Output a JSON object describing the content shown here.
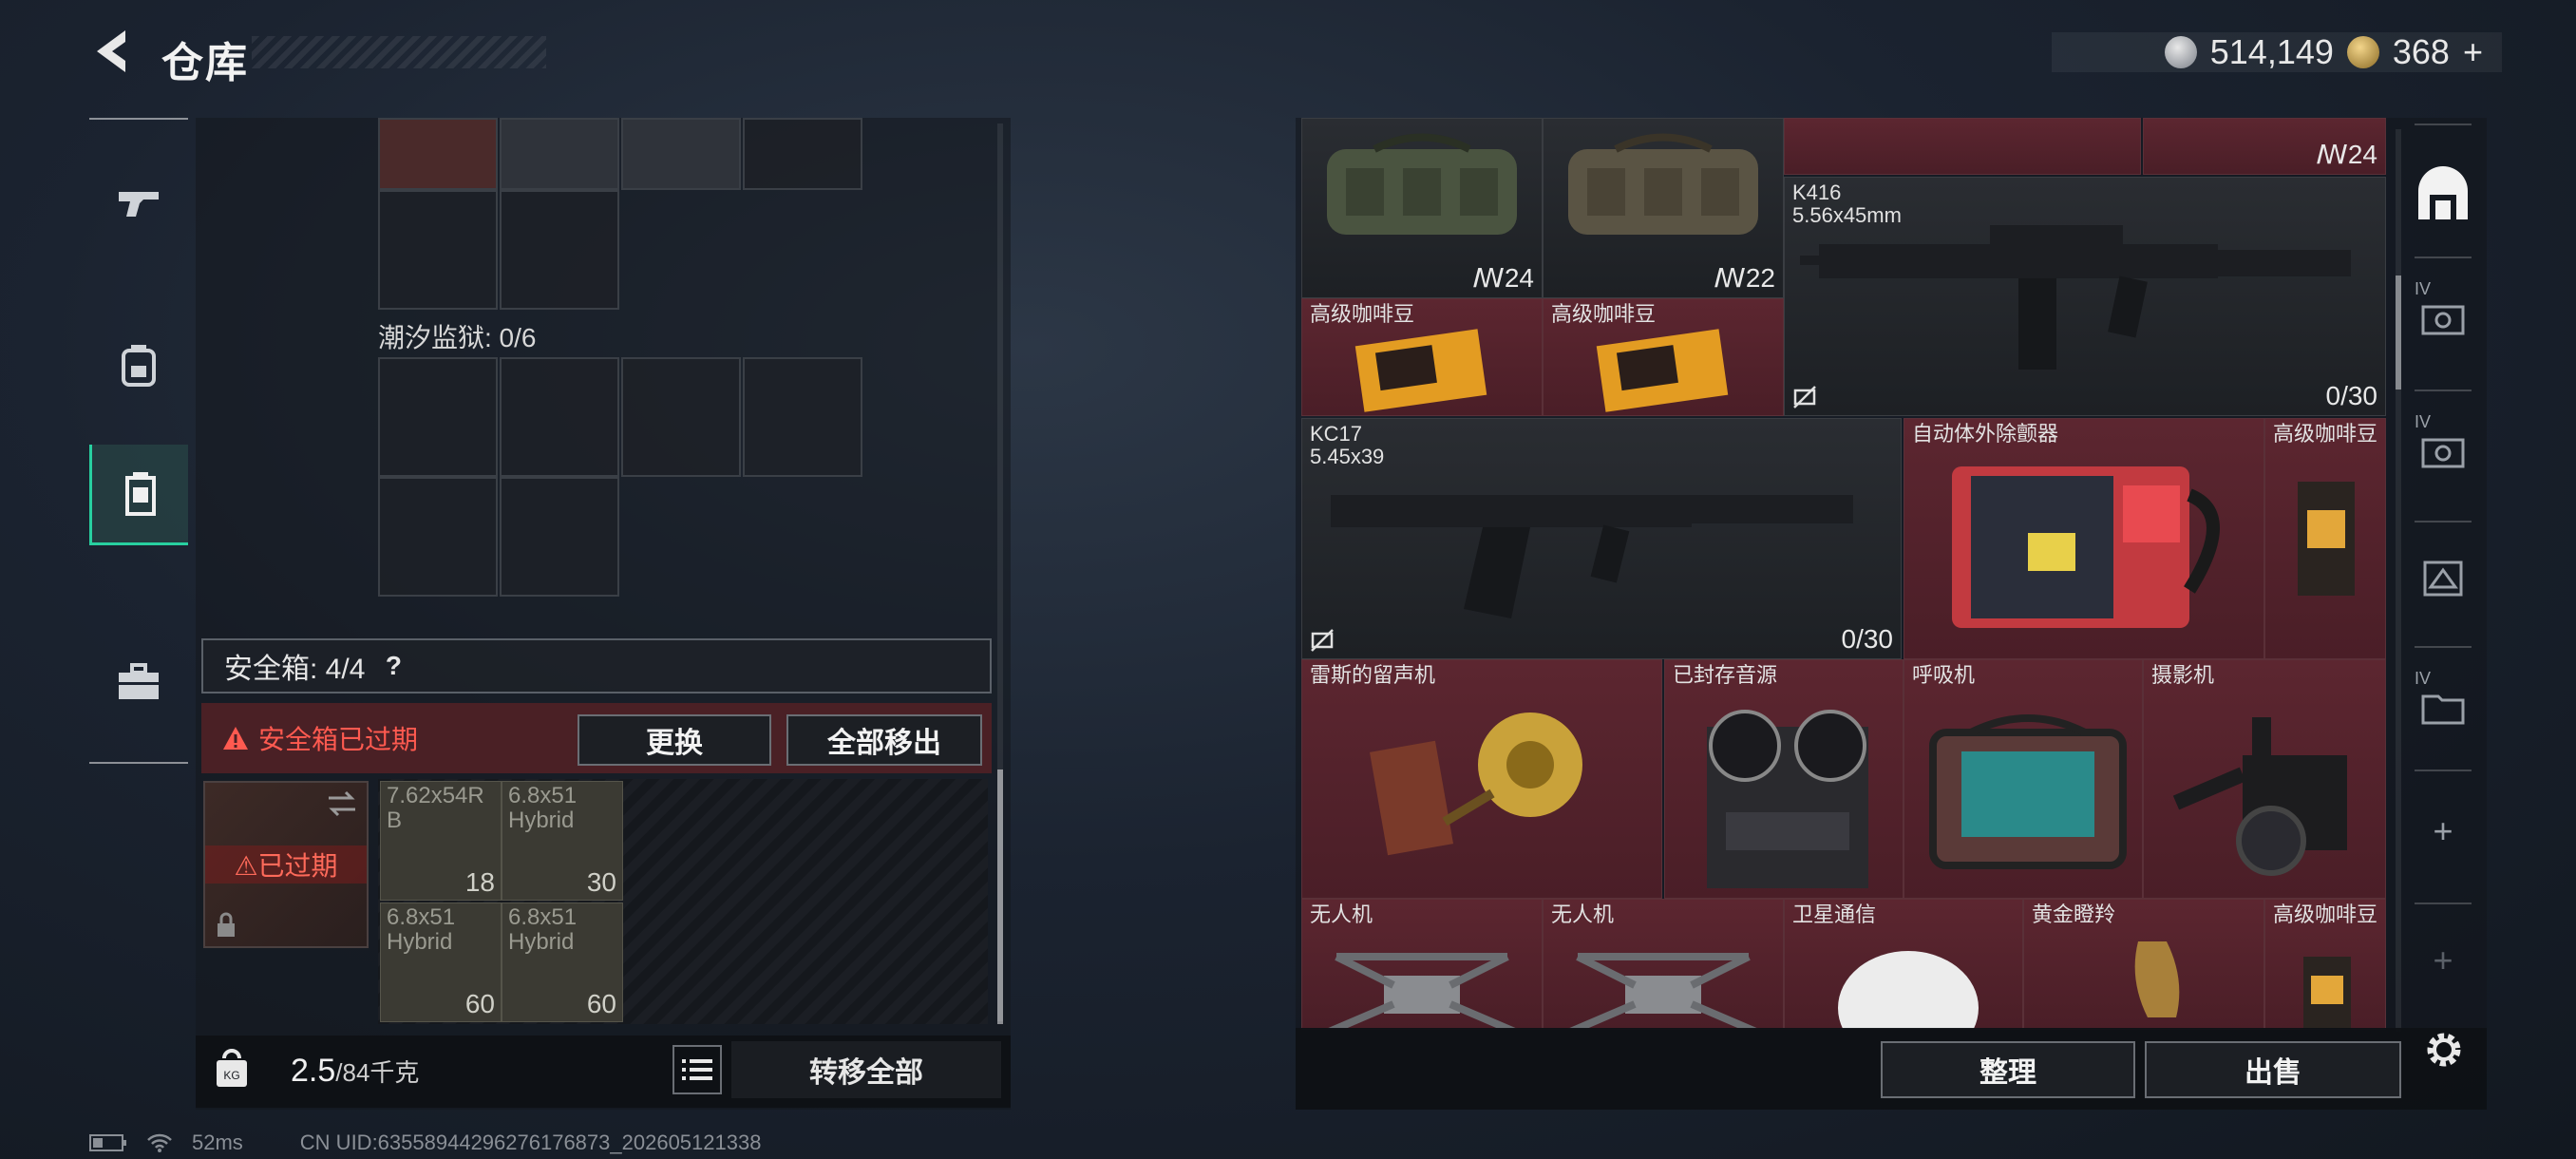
{
  "header": {
    "title": "仓库"
  },
  "currency": {
    "silver": "514,149",
    "gold": "368",
    "gold_add": "+"
  },
  "left": {
    "tidal_prison": "潮汐监狱: 0/6",
    "safebox_label": "安全箱: 4/4",
    "help": "?",
    "expired_msg": "安全箱已过期",
    "replace_btn": "更换",
    "moveout_btn": "全部移出",
    "safebox_item_status": "已过期",
    "ammo": [
      {
        "name": "7.62x54R\nB",
        "count": "18"
      },
      {
        "name": "6.8x51\nHybrid",
        "count": "30"
      },
      {
        "name": "6.8x51\nHybrid",
        "count": "60"
      },
      {
        "name": "6.8x51\nHybrid",
        "count": "60"
      }
    ],
    "weight_value": "2.5",
    "weight_max": "/84千克",
    "transfer_btn": "转移全部"
  },
  "status": {
    "ping": "52ms",
    "uid": "CN UID:63558944296276176873_202605121338"
  },
  "right": {
    "top_count": "24",
    "bag1_count": "24",
    "bag2_count": "22",
    "k416_name": "K416",
    "k416_ammo": "5.56x45mm",
    "k416_mag": "0/30",
    "coffee": "高级咖啡豆",
    "kc17_name": "KC17",
    "kc17_ammo": "5.45x39",
    "kc17_mag": "0/30",
    "defib": "自动体外除颤器",
    "gramophone": "雷斯的留声机",
    "sealed_audio": "已封存音源",
    "respirator": "呼吸机",
    "camera": "摄影机",
    "drone": "无人机",
    "satcom": "卫星通信",
    "antelope": "黄金瞪羚",
    "sort_btn": "整理",
    "sell_btn": "出售"
  },
  "right_nav": {
    "tier": "IV",
    "add": "+"
  },
  "colors": {
    "accent": "#28d0a0",
    "item_red": "#5c2630",
    "warning": "#ff5a50"
  }
}
